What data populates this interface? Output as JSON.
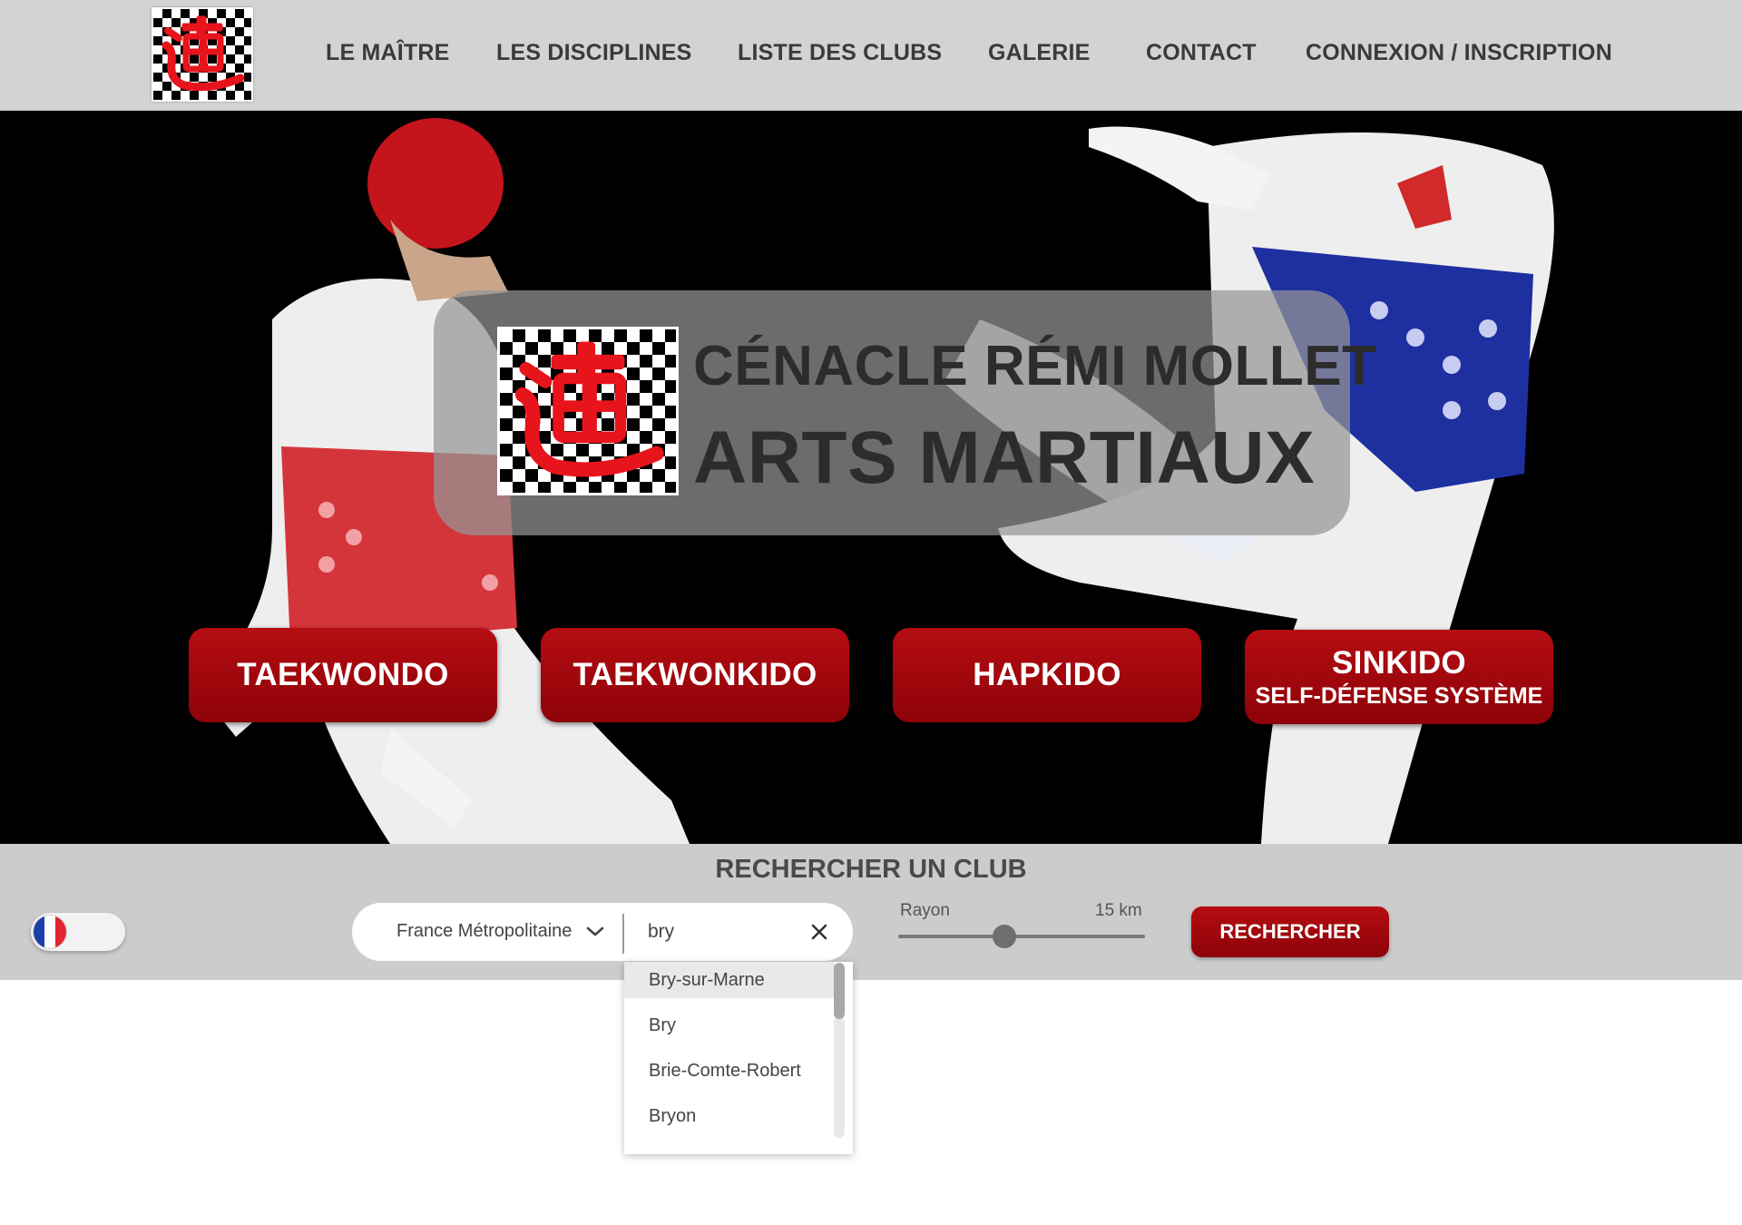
{
  "header": {
    "logo_alt": "Cénacle Rémi Mollet logo",
    "nav": [
      {
        "label": "LE MAÎTRE"
      },
      {
        "label": "LES DISCIPLINES"
      },
      {
        "label": "LISTE DES CLUBS"
      },
      {
        "label": "GALERIE"
      },
      {
        "label": "CONTACT"
      },
      {
        "label": "CONNEXION / INSCRIPTION"
      }
    ]
  },
  "hero": {
    "title_line1": "CÉNACLE RÉMI MOLLET",
    "title_line2": "ARTS MARTIAUX",
    "disciplines": [
      {
        "label": "TAEKWONDO",
        "sub": ""
      },
      {
        "label": "TAEKWONKIDO",
        "sub": ""
      },
      {
        "label": "HAPKIDO",
        "sub": ""
      },
      {
        "label": "SINKIDO",
        "sub": "SELF-DÉFENSE SYSTÈME"
      }
    ]
  },
  "search": {
    "title": "RECHERCHER UN CLUB",
    "region": "France Métropolitaine",
    "city_value": "bry",
    "radius_label": "Rayon",
    "radius_value": "15 km",
    "radius_fraction": 0.43,
    "submit_label": "RECHERCHER",
    "suggestions": [
      {
        "label": "Bry-sur-Marne",
        "active": true
      },
      {
        "label": "Bry",
        "active": false
      },
      {
        "label": "Brie-Comte-Robert",
        "active": false
      },
      {
        "label": "Bryon",
        "active": false
      }
    ]
  },
  "language": {
    "current": "fr"
  },
  "colors": {
    "brand_red": "#a30a0f",
    "header_bg": "#d3d3d3",
    "search_bg": "#cccccc"
  },
  "icons": {
    "logo": "dojo-kanji-checker-icon",
    "chevron": "chevron-down-icon",
    "clear": "close-icon",
    "flag": "france-flag-icon"
  }
}
